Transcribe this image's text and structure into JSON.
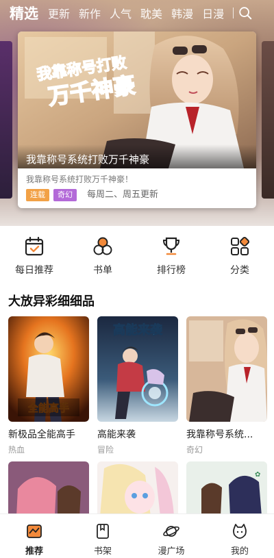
{
  "colors": {
    "accent": "#f2893a",
    "tag_serial": "#f2a146",
    "tag_fantasy": "#b36ad8"
  },
  "top_tabs": [
    {
      "label": "精选",
      "active": true
    },
    {
      "label": "更新"
    },
    {
      "label": "新作"
    },
    {
      "label": "人气"
    },
    {
      "label": "耽美"
    },
    {
      "label": "韩漫"
    },
    {
      "label": "日漫"
    }
  ],
  "search": {
    "icon": "search-icon"
  },
  "banner": {
    "art_title_line1": "我靠称号打败",
    "art_title_line2": "万千神豪",
    "caption": "我靠称号系统打败万千神豪",
    "subtitle": "我靠称号系统打败万千神豪！",
    "tags": [
      "连载",
      "奇幻"
    ],
    "update": "每周二、周五更新"
  },
  "quick_nav": [
    {
      "label": "每日推荐",
      "icon": "calendar-check-icon"
    },
    {
      "label": "书单",
      "icon": "three-circles-icon"
    },
    {
      "label": "排行榜",
      "icon": "trophy-icon"
    },
    {
      "label": "分类",
      "icon": "category-grid-icon"
    }
  ],
  "section": {
    "title": "大放异彩细细品"
  },
  "comics": [
    {
      "title": "新极品全能高手",
      "genre": "热血",
      "cover_text": "全能高手"
    },
    {
      "title": "高能来袭",
      "genre": "冒险",
      "cover_text": "高能来袭"
    },
    {
      "title": "我靠称号系统...",
      "genre": "奇幻",
      "cover_text": ""
    }
  ],
  "bottom_nav": [
    {
      "label": "推荐",
      "icon": "recommend-icon",
      "active": true
    },
    {
      "label": "书架",
      "icon": "bookshelf-icon"
    },
    {
      "label": "漫广场",
      "icon": "planet-icon"
    },
    {
      "label": "我的",
      "icon": "profile-cat-icon"
    }
  ]
}
